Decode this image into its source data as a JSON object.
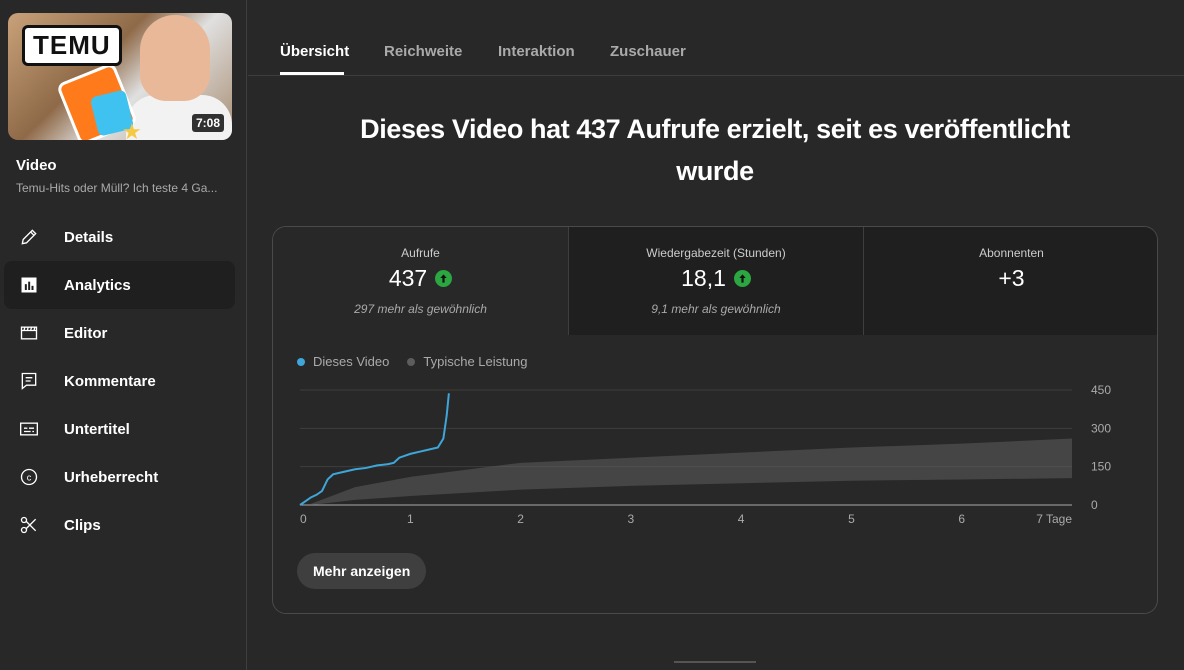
{
  "sidebar": {
    "thumbnail": {
      "badge_text": "TEMU",
      "duration": "7:08"
    },
    "video_label": "Video",
    "video_title": "Temu-Hits oder Müll? Ich teste 4 Ga...",
    "items": [
      {
        "label": "Details",
        "icon": "pencil-icon"
      },
      {
        "label": "Analytics",
        "icon": "analytics-icon",
        "active": true
      },
      {
        "label": "Editor",
        "icon": "clapperboard-icon"
      },
      {
        "label": "Kommentare",
        "icon": "comment-icon"
      },
      {
        "label": "Untertitel",
        "icon": "subtitles-icon"
      },
      {
        "label": "Urheberrecht",
        "icon": "copyright-icon"
      },
      {
        "label": "Clips",
        "icon": "scissors-icon"
      }
    ]
  },
  "tabs": [
    {
      "label": "Übersicht",
      "active": true
    },
    {
      "label": "Reichweite"
    },
    {
      "label": "Interaktion"
    },
    {
      "label": "Zuschauer"
    }
  ],
  "headline": "Dieses Video hat 437 Aufrufe erzielt, seit es veröffentlicht wurde",
  "metrics": [
    {
      "label": "Aufrufe",
      "value": "437",
      "trend": "up",
      "note": "297 mehr als gewöhnlich"
    },
    {
      "label": "Wiedergabezeit (Stunden)",
      "value": "18,1",
      "trend": "up",
      "note": "9,1 mehr als gewöhnlich"
    },
    {
      "label": "Abonnenten",
      "value": "+3",
      "note": ""
    }
  ],
  "legend": {
    "this_video": "Dieses Video",
    "typical": "Typische Leistung"
  },
  "colors": {
    "this_video": "#3ea6d8",
    "typical": "#5c5c5c",
    "up_arrow": "#2ba640"
  },
  "chart_data": {
    "type": "line",
    "x_tick_labels": [
      "0",
      "1",
      "2",
      "3",
      "4",
      "5",
      "6",
      "7 Tage"
    ],
    "y_tick_labels": [
      "450",
      "300",
      "150",
      "0"
    ],
    "xlim": [
      0,
      7
    ],
    "ylim": [
      0,
      450
    ],
    "series": [
      {
        "name": "Dieses Video",
        "x": [
          0,
          0.05,
          0.1,
          0.15,
          0.2,
          0.25,
          0.3,
          0.4,
          0.5,
          0.6,
          0.7,
          0.8,
          0.85,
          0.9,
          1.0,
          1.1,
          1.2,
          1.25,
          1.3,
          1.33,
          1.35
        ],
        "y": [
          0,
          15,
          30,
          40,
          55,
          100,
          120,
          130,
          140,
          145,
          155,
          160,
          165,
          185,
          200,
          210,
          220,
          225,
          260,
          350,
          437
        ]
      },
      {
        "name": "Typische Leistung",
        "x": [
          0.1,
          0.5,
          1.0,
          2.0,
          3.0,
          4.0,
          5.0,
          6.0,
          7.0
        ],
        "y_low": [
          0,
          20,
          35,
          60,
          75,
          85,
          95,
          100,
          105
        ],
        "y_high": [
          5,
          70,
          110,
          165,
          185,
          205,
          225,
          240,
          260
        ]
      }
    ]
  },
  "buttons": {
    "more": "Mehr anzeigen"
  }
}
